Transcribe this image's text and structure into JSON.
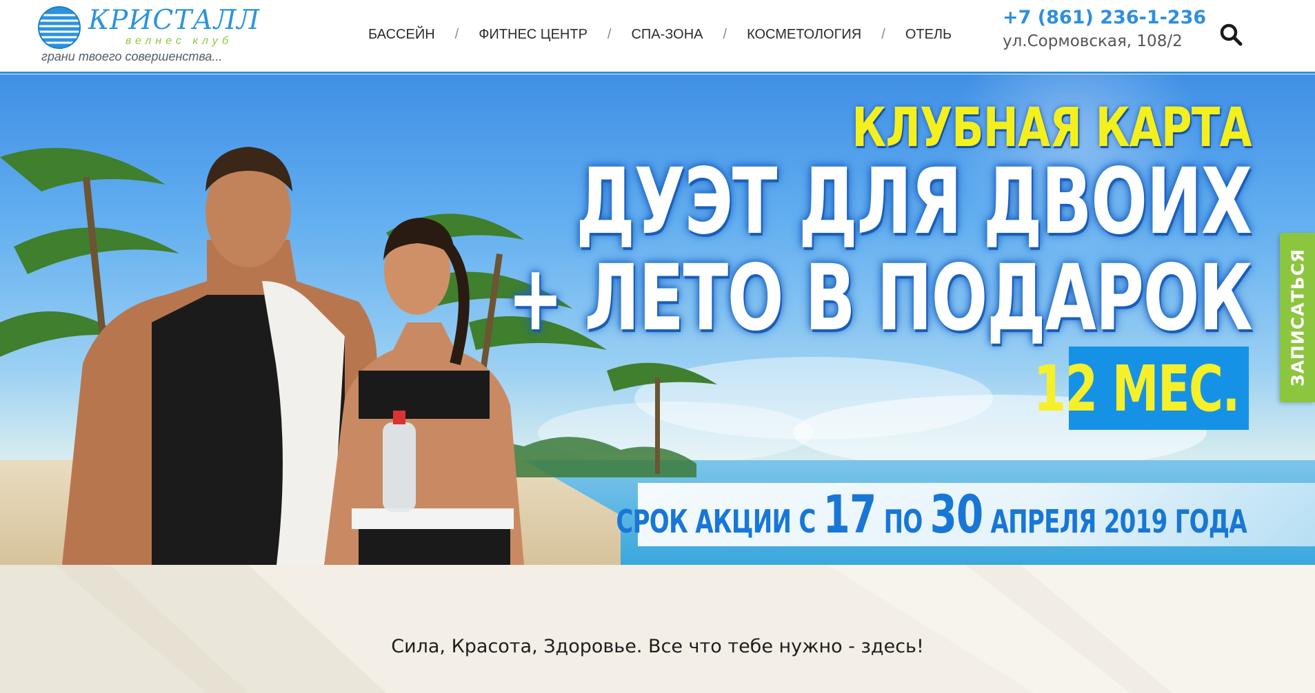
{
  "brand": {
    "name": "КРИСТАЛЛ",
    "subtitle": "велнес клуб",
    "slogan": "грани твоего совершенства..."
  },
  "nav": {
    "separator": "/",
    "items": [
      {
        "label": "БАССЕЙН"
      },
      {
        "label": "ФИТНЕС ЦЕНТР"
      },
      {
        "label": "СПА-ЗОНА"
      },
      {
        "label": "КОСМЕТОЛОГИЯ"
      },
      {
        "label": "ОТЕЛЬ"
      }
    ]
  },
  "contact": {
    "phone": "+7 (861) 236-1-236",
    "address": "ул.Сормовская, 108/2"
  },
  "search": {
    "icon": "search-icon"
  },
  "banner": {
    "line1": "КЛУБНАЯ КАРТА",
    "line2": "ДУЭТ ДЛЯ ДВОИХ",
    "line3": "+ ЛЕТО В ПОДАРОК",
    "duration": "12 МЕС.",
    "period": {
      "prefix": "СРОК АКЦИИ С",
      "from": "17",
      "by": "ПО",
      "to": "30",
      "suffix": "АПРЕЛЯ 2019 ГОДА"
    },
    "colors": {
      "headline_yellow": "#f4f01e",
      "accent_blue": "#1592e6"
    }
  },
  "signup_tab": {
    "label": "ЗАПИСАТЬСЯ",
    "color": "#8cc63f"
  },
  "tagline": "Сила, Красота, Здоровье. Все что тебе нужно - здесь!"
}
